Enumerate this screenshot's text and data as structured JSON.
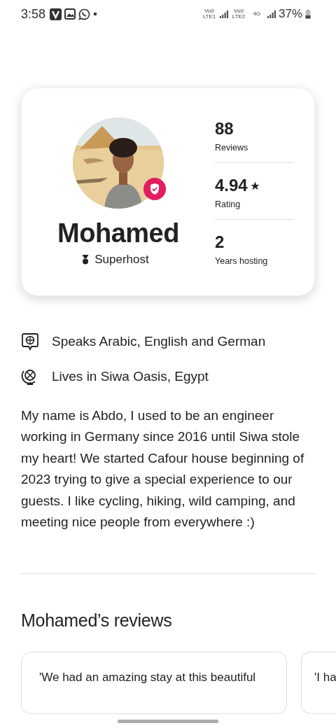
{
  "status_bar": {
    "time": "3:58",
    "sim_labels": [
      "Vo0 LTE1",
      "Vo0 LTE2",
      "4G"
    ],
    "battery": "37%"
  },
  "profile": {
    "name": "Mohamed",
    "verified": true,
    "badge": "Superhost",
    "stats": [
      {
        "value": "88",
        "label": "Reviews",
        "star": false
      },
      {
        "value": "4.94",
        "label": "Rating",
        "star": true
      },
      {
        "value": "2",
        "label": "Years hosting",
        "star": false
      }
    ]
  },
  "facts": [
    {
      "kind": "language",
      "text": "Speaks Arabic, English and German"
    },
    {
      "kind": "location",
      "text": "Lives in Siwa Oasis, Egypt"
    }
  ],
  "bio": "My name is Abdo, I used to be an engineer working in Germany since 2016 until Siwa stole my heart! We started Cafour house beginning of 2023 trying to give a special experience to our guests. I like cycling, hiking, wild camping, and meeting nice people from everywhere :)",
  "reviews_heading": "Mohamed’s reviews",
  "reviews": [
    {
      "text": "'We had an amazing stay at this beautiful"
    },
    {
      "text": "'I ha"
    }
  ]
}
